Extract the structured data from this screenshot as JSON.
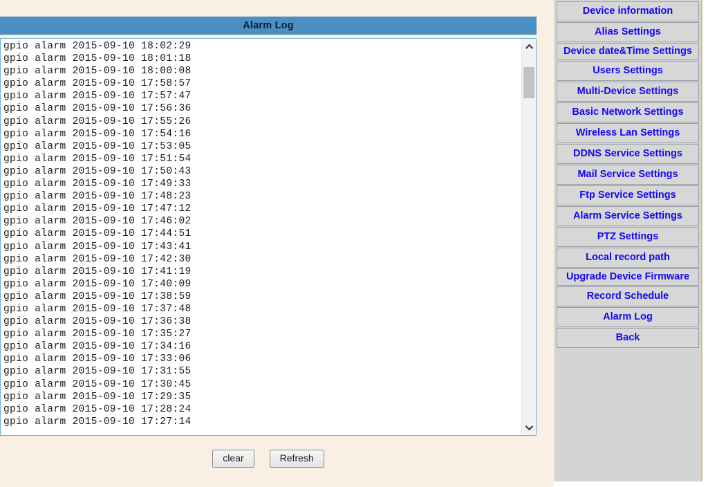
{
  "page": {
    "title": "Alarm Log",
    "background_color": "#faefe3",
    "titlebar_color": "#4a90c4",
    "sidebar_color": "#d4d4d4",
    "link_color": "#1406f5"
  },
  "log": {
    "lines": [
      "gpio alarm 2015-09-10 18:02:29",
      "gpio alarm 2015-09-10 18:01:18",
      "gpio alarm 2015-09-10 18:00:08",
      "gpio alarm 2015-09-10 17:58:57",
      "gpio alarm 2015-09-10 17:57:47",
      "gpio alarm 2015-09-10 17:56:36",
      "gpio alarm 2015-09-10 17:55:26",
      "gpio alarm 2015-09-10 17:54:16",
      "gpio alarm 2015-09-10 17:53:05",
      "gpio alarm 2015-09-10 17:51:54",
      "gpio alarm 2015-09-10 17:50:43",
      "gpio alarm 2015-09-10 17:49:33",
      "gpio alarm 2015-09-10 17:48:23",
      "gpio alarm 2015-09-10 17:47:12",
      "gpio alarm 2015-09-10 17:46:02",
      "gpio alarm 2015-09-10 17:44:51",
      "gpio alarm 2015-09-10 17:43:41",
      "gpio alarm 2015-09-10 17:42:30",
      "gpio alarm 2015-09-10 17:41:19",
      "gpio alarm 2015-09-10 17:40:09",
      "gpio alarm 2015-09-10 17:38:59",
      "gpio alarm 2015-09-10 17:37:48",
      "gpio alarm 2015-09-10 17:36:38",
      "gpio alarm 2015-09-10 17:35:27",
      "gpio alarm 2015-09-10 17:34:16",
      "gpio alarm 2015-09-10 17:33:06",
      "gpio alarm 2015-09-10 17:31:55",
      "gpio alarm 2015-09-10 17:30:45",
      "gpio alarm 2015-09-10 17:29:35",
      "gpio alarm 2015-09-10 17:28:24",
      "gpio alarm 2015-09-10 17:27:14"
    ]
  },
  "scrollbar": {
    "up_icon": "chevron-up-icon",
    "down_icon": "chevron-down-icon"
  },
  "buttons": {
    "clear_label": "clear",
    "refresh_label": "Refresh"
  },
  "sidebar": {
    "items": [
      {
        "label": "Device information",
        "two_line": false
      },
      {
        "label": "Alias Settings",
        "two_line": false
      },
      {
        "label": "Device date&Time Settings",
        "two_line": true
      },
      {
        "label": "Users Settings",
        "two_line": false
      },
      {
        "label": "Multi-Device Settings",
        "two_line": false
      },
      {
        "label": "Basic Network Settings",
        "two_line": false
      },
      {
        "label": "Wireless Lan Settings",
        "two_line": false
      },
      {
        "label": "DDNS Service Settings",
        "two_line": false
      },
      {
        "label": "Mail Service Settings",
        "two_line": false
      },
      {
        "label": "Ftp Service Settings",
        "two_line": false
      },
      {
        "label": "Alarm Service Settings",
        "two_line": false
      },
      {
        "label": "PTZ Settings",
        "two_line": false
      },
      {
        "label": "Local record path",
        "two_line": false
      },
      {
        "label": "Upgrade Device Firmware",
        "two_line": true
      },
      {
        "label": "Record Schedule",
        "two_line": false
      },
      {
        "label": "Alarm Log",
        "two_line": false
      },
      {
        "label": "Back",
        "two_line": false
      }
    ]
  }
}
